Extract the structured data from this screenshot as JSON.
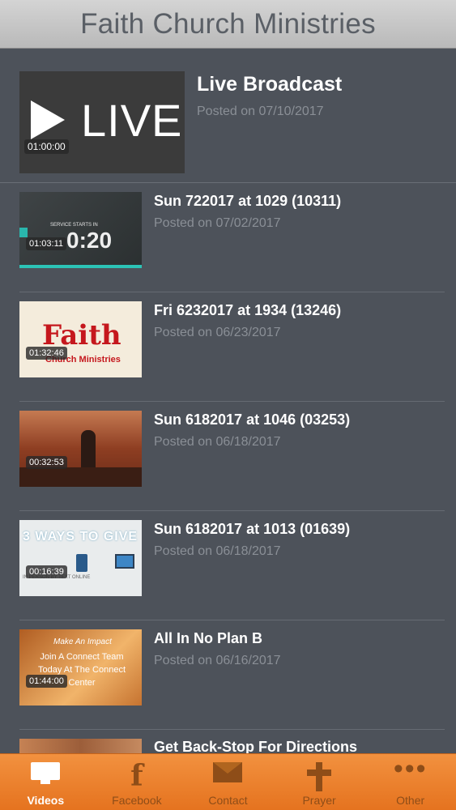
{
  "header": {
    "title": "Faith Church Ministries"
  },
  "featured": {
    "title": "Live Broadcast",
    "posted": "Posted on 07/10/2017",
    "duration": "01:00:00",
    "thumb_text": "LIVE"
  },
  "videos": [
    {
      "title": "Sun 722017 at 1029 (10311)",
      "posted": "Posted on 07/02/2017",
      "duration": "01:03:11",
      "thumb_caption": "SERVICE STARTS IN",
      "thumb_text": "0:20"
    },
    {
      "title": "Fri 6232017 at 1934 (13246)",
      "posted": "Posted on 06/23/2017",
      "duration": "01:32:46",
      "thumb_text": "Faith",
      "thumb_caption": "Church Ministries"
    },
    {
      "title": "Sun 6182017 at 1046 (03253)",
      "posted": "Posted on 06/18/2017",
      "duration": "00:32:53"
    },
    {
      "title": "Sun 6182017 at 1013 (01639)",
      "posted": "Posted on 06/18/2017",
      "duration": "00:16:39",
      "thumb_text": "3 WAYS TO GIVE",
      "thumb_caption": "IN PERSON    BY TEXT       ONLINE"
    },
    {
      "title": "All In No Plan B",
      "posted": "Posted on 06/16/2017",
      "duration": "01:44:00",
      "thumb_caption": "Make An Impact",
      "thumb_text": "Join A Connect Team Today At The Connect Center"
    },
    {
      "title": "Get Back-Stop For Directions"
    }
  ],
  "tabs": [
    {
      "label": "Videos",
      "icon": "monitor-icon",
      "active": true
    },
    {
      "label": "Facebook",
      "icon": "facebook-icon"
    },
    {
      "label": "Contact",
      "icon": "mail-icon"
    },
    {
      "label": "Prayer",
      "icon": "cross-icon"
    },
    {
      "label": "Other",
      "icon": "more-icon"
    }
  ],
  "colors": {
    "accent": "#ee8530",
    "background": "#4d525a",
    "active_tab_text": "#ffffff",
    "inactive_tab_text": "#8e4d18"
  }
}
